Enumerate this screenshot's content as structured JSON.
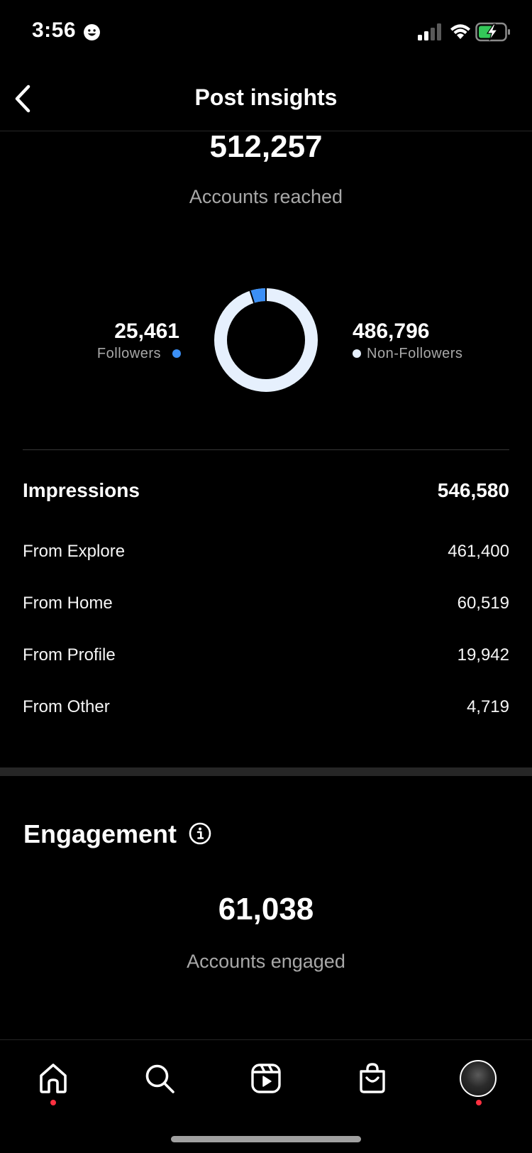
{
  "status_bar": {
    "time": "3:56"
  },
  "header": {
    "title": "Post insights"
  },
  "reach": {
    "value": "512,257",
    "label": "Accounts reached",
    "followers": {
      "value": "25,461",
      "label": "Followers",
      "color": "#3b8ff5",
      "share": 0.0497
    },
    "non_followers": {
      "value": "486,796",
      "label": "Non-Followers",
      "color": "#e6f0fd",
      "share": 0.9503
    }
  },
  "impressions": {
    "title": "Impressions",
    "total": "546,580",
    "rows": [
      {
        "label": "From Explore",
        "value": "461,400"
      },
      {
        "label": "From Home",
        "value": "60,519"
      },
      {
        "label": "From Profile",
        "value": "19,942"
      },
      {
        "label": "From Other",
        "value": "4,719"
      }
    ]
  },
  "engagement": {
    "title": "Engagement",
    "value": "61,038",
    "label": "Accounts engaged"
  },
  "tab_bar": {
    "tabs": [
      {
        "name": "home",
        "icon": "home-icon",
        "has_notification": true
      },
      {
        "name": "search",
        "icon": "search-icon",
        "has_notification": false
      },
      {
        "name": "reels",
        "icon": "reels-icon",
        "has_notification": false
      },
      {
        "name": "shop",
        "icon": "shop-icon",
        "has_notification": false
      },
      {
        "name": "profile",
        "icon": "avatar",
        "has_notification": true
      }
    ]
  }
}
